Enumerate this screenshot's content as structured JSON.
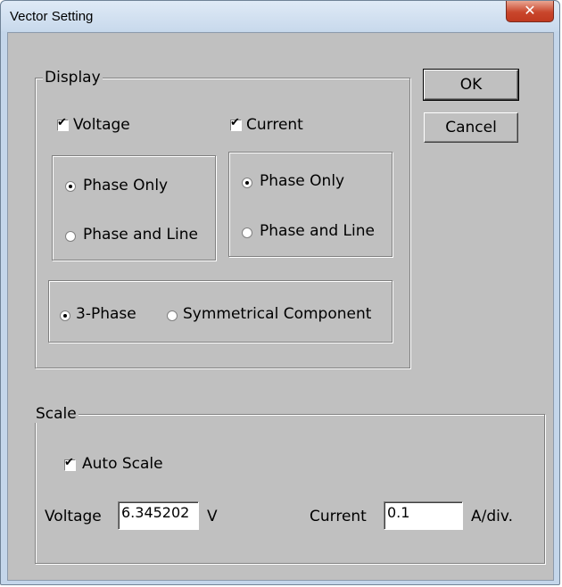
{
  "window": {
    "title": "Vector Setting",
    "close_glyph": "✕"
  },
  "buttons": {
    "ok": "OK",
    "cancel": "Cancel"
  },
  "display": {
    "legend": "Display",
    "voltage": {
      "label": "Voltage",
      "checked": true
    },
    "current": {
      "label": "Current",
      "checked": true
    },
    "voltage_mode": {
      "phase_only": "Phase Only",
      "phase_and_line": "Phase and Line",
      "selected": "Phase Only"
    },
    "current_mode": {
      "phase_only": "Phase Only",
      "phase_and_line": "Phase and Line",
      "selected": "Phase Only"
    },
    "component": {
      "three_phase": "3-Phase",
      "symmetrical": "Symmetrical Component",
      "selected": "3-Phase"
    }
  },
  "scale": {
    "legend": "Scale",
    "auto_scale": {
      "label": "Auto Scale",
      "checked": true
    },
    "voltage_label": "Voltage",
    "voltage_value": "6.345202",
    "voltage_unit": "V",
    "current_label": "Current",
    "current_value": "0.1",
    "current_unit": "A/div."
  },
  "check_glyph": "✔"
}
